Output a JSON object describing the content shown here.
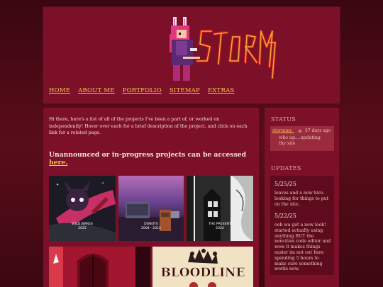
{
  "brand": {
    "logo_text": "STORMY",
    "accent": "#f2c84b"
  },
  "nav": [
    "HOME",
    "ABOUT ME",
    "PORTFOLIO",
    "SITEMAP",
    "EXTRAS"
  ],
  "intro": "Hi there, here's a list of all of the projects I've been a part of, or worked on independently! Hover over each for a brief description of the project, and click on each link for a related page.",
  "progress": {
    "text": "Unannounced or in-progress projects can be accessed ",
    "link": "here."
  },
  "projects": [
    {
      "title": "WILD WARES",
      "years": "2025"
    },
    {
      "title": "DONUTS",
      "years": "2004 - 2015"
    },
    {
      "title": "THE PRESENT",
      "years": "2024"
    },
    {
      "title": "",
      "years": ""
    },
    {
      "title": "BLOODLINE",
      "years": ""
    }
  ],
  "sidebar": {
    "status_heading": "STATUS",
    "status": {
      "user": "stormmy_",
      "icon": "skull-icon",
      "time": "57 days ago",
      "message": "who up....updating thy site"
    },
    "updates_heading": "UPDATES",
    "updates": [
      {
        "date": "5/25/25",
        "text": "leaves and a new hire. looking for things to put on the site.."
      },
      {
        "date": "5/22/25",
        "text": "ooh wa got a new look! started actually using anything BUT the neocities code editor and wow it makes things easier im not out here spending 5 hours to make sure something works now."
      }
    ]
  }
}
